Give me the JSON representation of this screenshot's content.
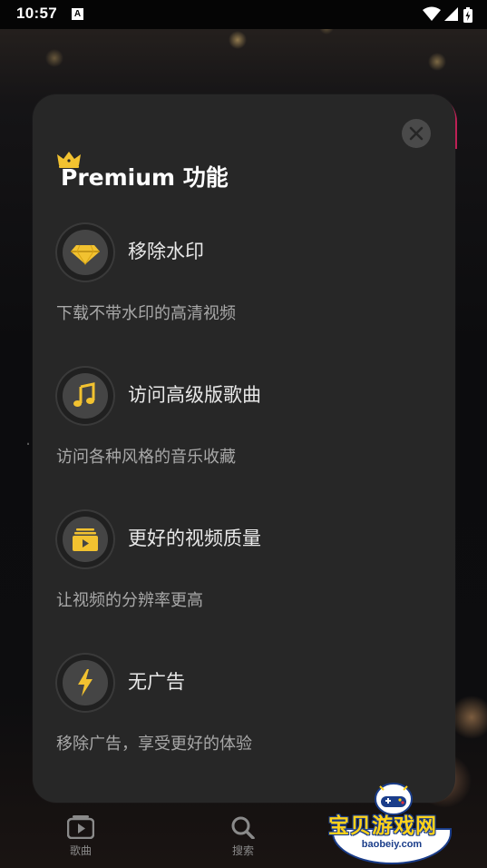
{
  "status_bar": {
    "time": "10:57",
    "notification_glyph": "A",
    "icons": [
      "wifi-icon",
      "signal-icon",
      "battery-icon"
    ]
  },
  "background_app": {
    "tabs": [
      {
        "label": "歌曲",
        "icon": "play-icon"
      },
      {
        "label": "搜索",
        "icon": "search-icon"
      }
    ]
  },
  "modal": {
    "title": "Premium 功能",
    "title_icon": "crown-icon",
    "close_icon": "close-icon",
    "features": [
      {
        "icon": "diamond-icon",
        "title": "移除水印",
        "description": "下载不带水印的高清视频"
      },
      {
        "icon": "music-note-icon",
        "title": "访问高级版歌曲",
        "description": "访问各种风格的音乐收藏"
      },
      {
        "icon": "video-quality-icon",
        "title": "更好的视频质量",
        "description": "让视频的分辨率更高"
      },
      {
        "icon": "lightning-icon",
        "title": "无广告",
        "description": "移除广告，享受更好的体验"
      }
    ]
  },
  "watermark": {
    "text": "宝贝游戏网",
    "url": "baobeiy.com"
  },
  "colors": {
    "modal_background": "#272727",
    "icon_gold": "#f2c230",
    "accent_pink": "#d0205a",
    "watermark_yellow": "#ffd21a",
    "watermark_blue": "#1a3d8a"
  }
}
